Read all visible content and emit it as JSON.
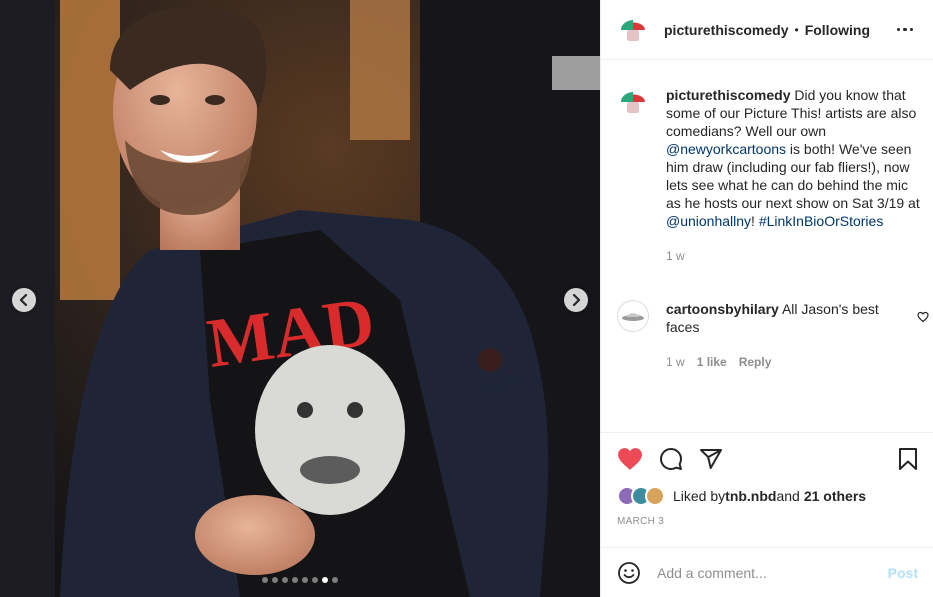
{
  "post": {
    "username": "picturethiscomedy",
    "separator": "•",
    "follow_status": "Following",
    "more_icon": "more-horizontal-icon",
    "caption": {
      "username": "picturethiscomedy",
      "text_1": " Did you know that some of our Picture This! artists are also comedians? Well our own ",
      "mention_1": "@newyorkcartoons",
      "text_2": " is both! We've seen him draw (including our fab fliers!), now lets see what he can do behind the mic as he hosts our next show on Sat 3/19 at ",
      "mention_2": "@unionhallny",
      "text_3": "! ",
      "hashtag": "#LinkInBioOrStories",
      "age": "1 w"
    },
    "comment": {
      "username": "cartoonsbyhilary",
      "text": " All Jason's best faces",
      "age": "1 w",
      "likes": "1 like",
      "reply": "Reply"
    },
    "liked_by": {
      "prefix": "Liked by ",
      "user": "tnb.nbd",
      "and": " and ",
      "others": "21 others"
    },
    "date": "MARCH 3",
    "add_comment_placeholder": "Add a comment...",
    "post_button": "Post"
  },
  "carousel": {
    "total": 8,
    "active_index": 6
  },
  "shirt_text": "MAD",
  "colors": {
    "like_red": "#ed4956",
    "link_blue": "#00376b",
    "post_disabled": "#b2dffc",
    "muted": "#8e8e8e"
  }
}
